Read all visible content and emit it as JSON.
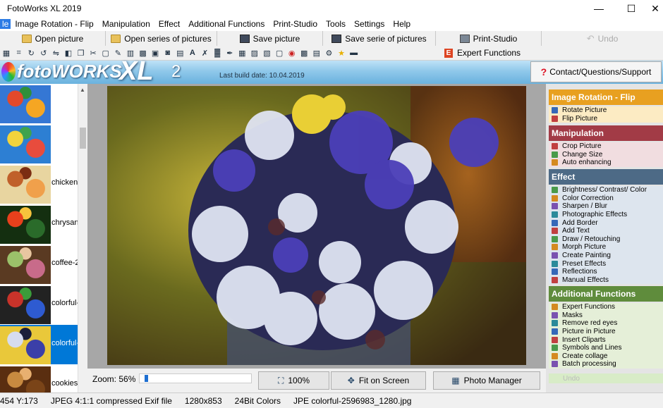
{
  "title": "FotoWorks XL 2019",
  "window_controls": [
    "—",
    "☐",
    "✕"
  ],
  "menu": [
    "le",
    "Image Rotation - Flip",
    "Manipulation",
    "Effect",
    "Additional Functions",
    "Print-Studio",
    "Tools",
    "Settings",
    "Help"
  ],
  "toolbar": {
    "open_picture": "Open picture",
    "open_series": "Open series of pictures",
    "save_picture": "Save picture",
    "save_series": "Save serie of pictures",
    "print_studio": "Print-Studio",
    "undo": "Undo",
    "expert_functions": "Expert Functions"
  },
  "banner": {
    "logo_main": "fotoWORKS",
    "logo_xl": "XL",
    "logo_version": "2",
    "build_date": "Last build date: 10.04.2019",
    "contact": "Contact/Questions/Support"
  },
  "thumbnails": [
    {
      "label": "",
      "colors": [
        "#e2492b",
        "#f5a623",
        "#2f8f3a",
        "#3577d4"
      ]
    },
    {
      "label": "",
      "colors": [
        "#f2d33c",
        "#e84c3d",
        "#3fa34d",
        "#2d7fd3"
      ]
    },
    {
      "label": "chicken",
      "colors": [
        "#c0602a",
        "#f0a04b",
        "#7b2d12",
        "#e8d5a0"
      ]
    },
    {
      "label": "chrysan",
      "colors": [
        "#e8401c",
        "#2a6b2a",
        "#f6c23c",
        "#142f10"
      ]
    },
    {
      "label": "coffee-2",
      "colors": [
        "#9bc16a",
        "#c86b8a",
        "#e8c6a0",
        "#5a3a22"
      ]
    },
    {
      "label": "colorful-",
      "colors": [
        "#c8332a",
        "#2e5bd1",
        "#3a9c3a",
        "#222"
      ]
    },
    {
      "label": "colorful-",
      "colors": [
        "#d6dcef",
        "#3b3fa8",
        "#1b1f3a",
        "#e9c83a"
      ],
      "selected": true
    },
    {
      "label": "cookies",
      "colors": [
        "#c88a40",
        "#7a4418",
        "#e8b070",
        "#5a2e10"
      ]
    }
  ],
  "zoom": {
    "label": "Zoom: 56%",
    "value_percent": 56
  },
  "bottom_buttons": {
    "b100": "100%",
    "fit": "Fit on Screen",
    "manager": "Photo Manager"
  },
  "sidebar": {
    "sections": [
      {
        "title": "Image Rotation - Flip",
        "color": "#e8a020",
        "bg": "#fcebc3",
        "items": [
          "Rotate Picture",
          "Flip Picture"
        ]
      },
      {
        "title": "Manipulation",
        "color": "#a23b46",
        "bg": "#f1dde0",
        "items": [
          "Crop Picture",
          "Change Size",
          "Auto enhancing"
        ]
      },
      {
        "title": "Effect",
        "color": "#4d6a86",
        "bg": "#dde5ee",
        "items": [
          "Brightness/ Contrast/ Color",
          "Color Correction",
          "Sharpen / Blur",
          "Photographic Effects",
          "Add Border",
          "Add Text",
          "Draw / Retouching",
          "Morph Picture",
          "Create Painting",
          "Preset Effects",
          "Reflections",
          "Manual Effects"
        ]
      },
      {
        "title": "Additional Functions",
        "color": "#5f8c3c",
        "bg": "#e5efd8",
        "items": [
          "Expert Functions",
          "Masks",
          "Remove red eyes",
          "Picture in Picture",
          "Insert Cliparts",
          "Symbols and Lines",
          "Create collage",
          "Batch processing"
        ]
      }
    ],
    "undo": "Undo"
  },
  "status": {
    "coords": "454 Y:173",
    "format": "JPEG 4:1:1 compressed Exif file",
    "size": "1280x853",
    "depth": "24Bit Colors",
    "file": "JPE colorful-2596983_1280.jpg"
  }
}
